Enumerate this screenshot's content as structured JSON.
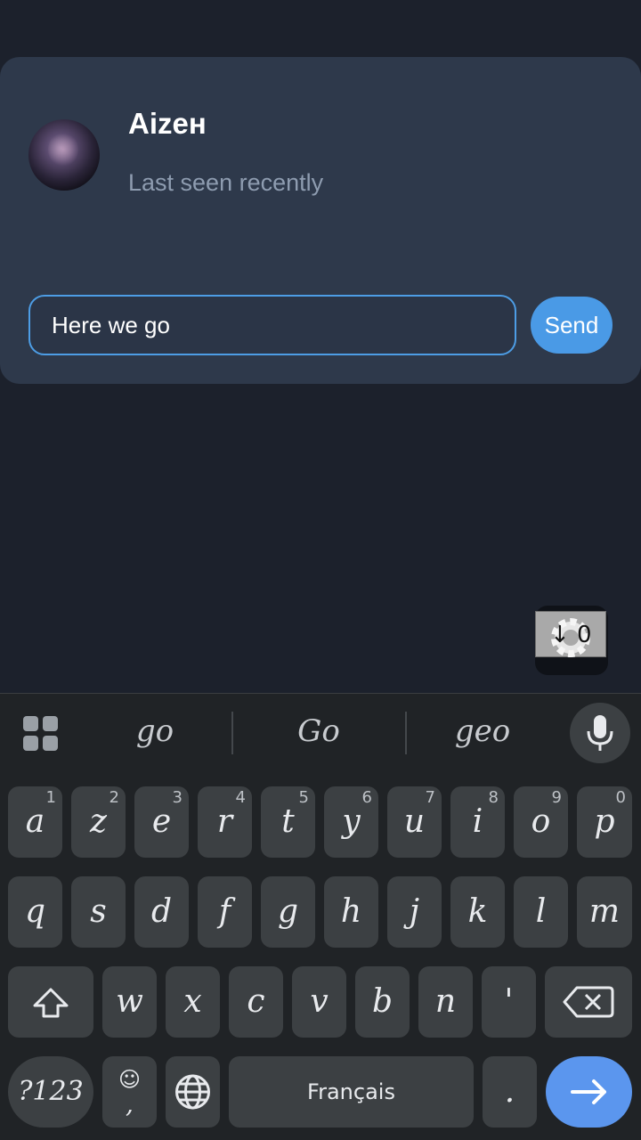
{
  "chat": {
    "contact_name": "Aizeн",
    "status": "Last seen recently",
    "message_value": "Here we go",
    "send_label": "Send"
  },
  "float_widget": {
    "text": "↓ 0"
  },
  "keyboard": {
    "suggestions": [
      "go",
      "Go",
      "geo"
    ],
    "row1": [
      {
        "key": "a",
        "hint": "1"
      },
      {
        "key": "z",
        "hint": "2"
      },
      {
        "key": "e",
        "hint": "3"
      },
      {
        "key": "r",
        "hint": "4"
      },
      {
        "key": "t",
        "hint": "5"
      },
      {
        "key": "y",
        "hint": "6"
      },
      {
        "key": "u",
        "hint": "7"
      },
      {
        "key": "i",
        "hint": "8"
      },
      {
        "key": "o",
        "hint": "9"
      },
      {
        "key": "p",
        "hint": "0"
      }
    ],
    "row2": [
      "q",
      "s",
      "d",
      "f",
      "g",
      "h",
      "j",
      "k",
      "l",
      "m"
    ],
    "row3": [
      "w",
      "x",
      "c",
      "v",
      "b",
      "n",
      "'"
    ],
    "symbols_label": "?123",
    "emoji_label": "☺",
    "comma_label": ",",
    "space_label": "Français",
    "period_label": "."
  },
  "colors": {
    "accent": "#4a9ae6",
    "card": "#2e394b",
    "background": "#1c212c",
    "keyboard": "#202326",
    "key": "#3c4043",
    "enter": "#5b96ee"
  }
}
